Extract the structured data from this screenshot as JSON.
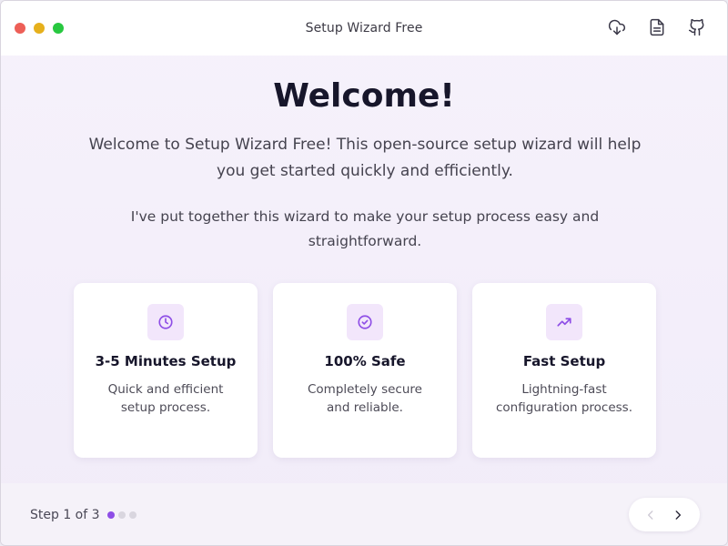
{
  "window": {
    "title": "Setup Wizard Free",
    "controls": [
      "close",
      "minimize",
      "zoom"
    ],
    "toolbar_icons": [
      "download-cloud-icon",
      "document-icon",
      "github-icon"
    ]
  },
  "main": {
    "heading": "Welcome!",
    "intro": "Welcome to Setup Wizard Free! This open-source setup wizard will help you get started quickly and efficiently.",
    "subtext": "I've put together this wizard to make your setup process easy and straightforward.",
    "features": [
      {
        "icon": "clock-icon",
        "title": "3-5 Minutes Setup",
        "description": "Quick and efficient setup process."
      },
      {
        "icon": "check-circle-icon",
        "title": "100% Safe",
        "description": "Completely secure and reliable."
      },
      {
        "icon": "trending-up-icon",
        "title": "Fast Setup",
        "description": "Lightning-fast configuration process."
      }
    ]
  },
  "footer": {
    "step_label": "Step 1 of 3",
    "current_step": 1,
    "total_steps": 3,
    "prev_icon": "chevron-left-icon",
    "next_icon": "chevron-right-icon"
  },
  "colors": {
    "accent": "#8e4ee6",
    "icon_bg": "#f2e6fb",
    "close": "#ed5f57",
    "minimize": "#e6b01c",
    "zoom": "#28c840"
  }
}
